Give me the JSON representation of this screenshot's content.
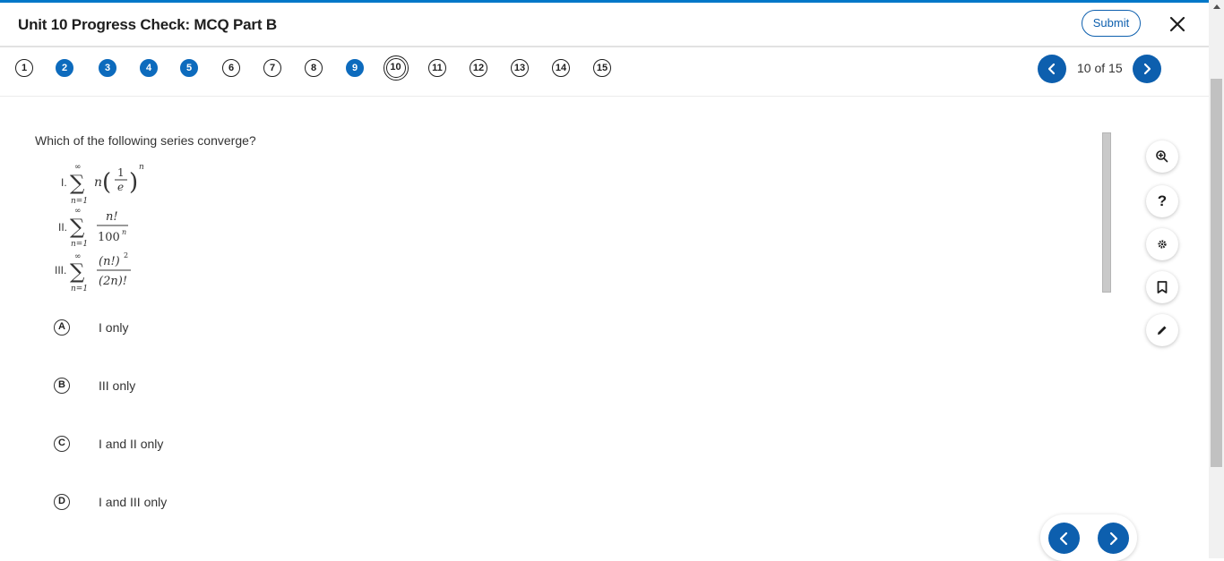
{
  "header": {
    "title": "Unit 10 Progress Check: MCQ Part B",
    "submit_label": "Submit"
  },
  "question_nav": {
    "numbers": [
      "1",
      "2",
      "3",
      "4",
      "5",
      "6",
      "7",
      "8",
      "9",
      "10",
      "11",
      "12",
      "13",
      "14",
      "15"
    ],
    "answered": [
      "2",
      "3",
      "4",
      "5",
      "9"
    ],
    "current": "10",
    "page_indicator": "10 of 15"
  },
  "question": {
    "prompt": "Which of the following series converge?",
    "series": [
      {
        "label": "I.",
        "term": "n (1/e)^n",
        "from": "n=1",
        "to": "∞"
      },
      {
        "label": "II.",
        "term": "n! / 100^n",
        "from": "n=1",
        "to": "∞"
      },
      {
        "label": "III.",
        "term": "(n!)^2 / (2n)!",
        "from": "n=1",
        "to": "∞"
      }
    ]
  },
  "choices": [
    {
      "letter": "A",
      "text": "I only"
    },
    {
      "letter": "B",
      "text": "III only"
    },
    {
      "letter": "C",
      "text": "I and II only"
    },
    {
      "letter": "D",
      "text": "I and III only"
    }
  ],
  "tools": [
    "zoom-in-icon",
    "help-icon",
    "settings-icon",
    "bookmark-icon",
    "pencil-icon"
  ],
  "tool_labels": {
    "help": "?"
  },
  "colors": {
    "accent": "#0d6bbd",
    "topbar": "#0077c8"
  }
}
